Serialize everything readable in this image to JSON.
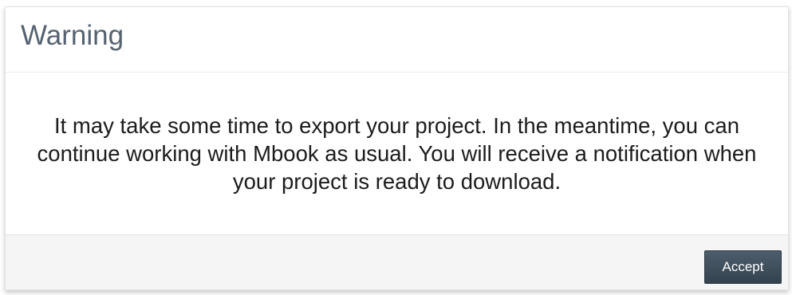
{
  "dialog": {
    "title": "Warning",
    "message": "It may take some time to export your project. In the meantime, you can continue working with Mbook as usual. You will receive a notification when your project is ready to download.",
    "accept_label": "Accept"
  },
  "colors": {
    "title_text": "#556270",
    "button_background": "#3e4c59",
    "footer_background": "#f5f5f5"
  }
}
